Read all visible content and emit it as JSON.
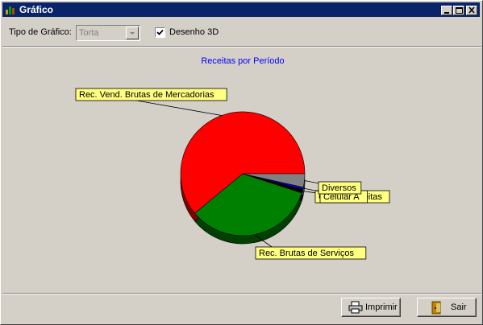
{
  "window": {
    "title": "Gráfico"
  },
  "toolbar": {
    "chart_type_label": "Tipo de Gráfico:",
    "chart_type_value": "Torta",
    "draw3d_label": "Desenho 3D",
    "draw3d_checked": true
  },
  "chart_data": {
    "type": "pie",
    "title": "Receitas por Período",
    "title_color": "#0000ff",
    "three_d": true,
    "slices": [
      {
        "label": "Rec. Vend. Brutas de Mercadorias",
        "value": 61,
        "color": "#ff0000"
      },
      {
        "label": "Rec. Brutas de Serviços",
        "value": 34,
        "color": "#008000"
      },
      {
        "label": "Outras Receitas",
        "value": 1,
        "color": "#000000"
      },
      {
        "label": "Celular A",
        "value": 0.5,
        "color": "#0000ff"
      },
      {
        "label": "Diversos",
        "value": 3.5,
        "color": "#808080"
      }
    ],
    "label_bg": "#ffff80"
  },
  "buttons": {
    "print": "Imprimir",
    "exit": "Sair"
  }
}
